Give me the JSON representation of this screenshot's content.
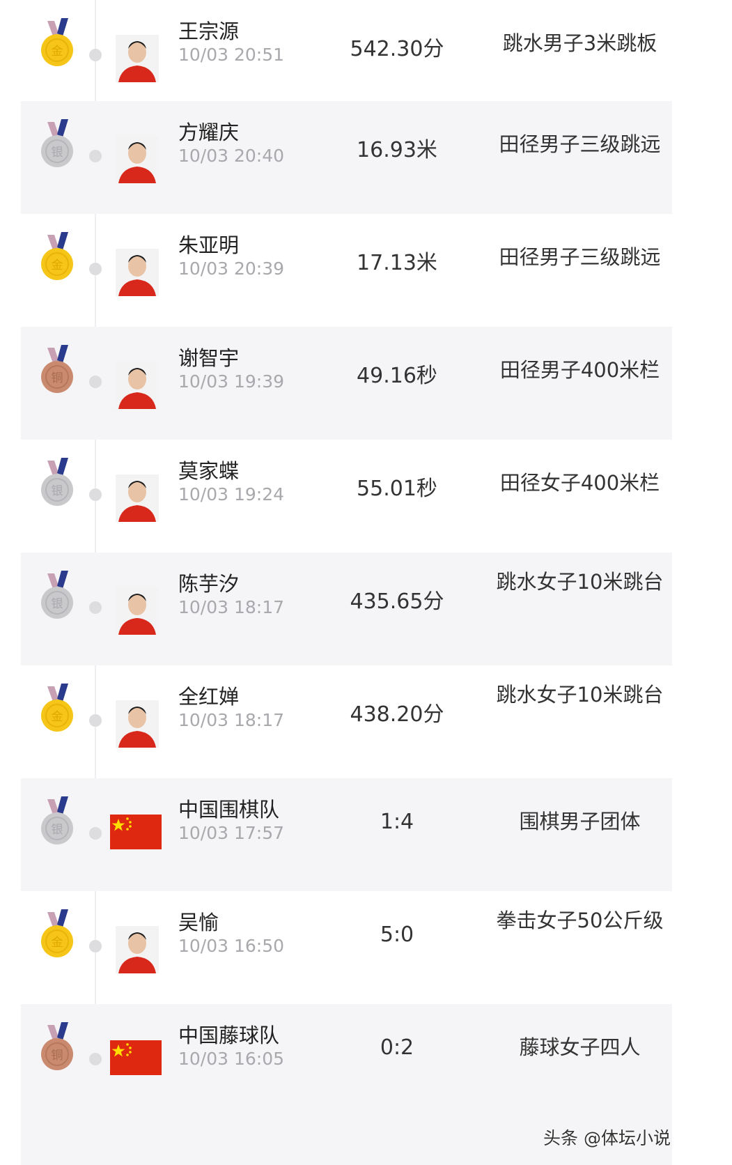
{
  "colors": {
    "gold": "#f5c518",
    "silver": "#c9c9cc",
    "bronze": "#c98a6f",
    "ribbon_blue": "#2a3a8c",
    "ribbon_pink": "#c7a0b4",
    "flag_red": "#de2910",
    "flag_star": "#ffde00"
  },
  "medal_labels": {
    "gold": "金",
    "silver": "银",
    "bronze": "铜"
  },
  "entries": [
    {
      "medal": "gold",
      "avatar": "athlete-photo",
      "name": "王宗源",
      "time": "10/03 20:51",
      "score": "542.30分",
      "event": "跳水男子3米跳板"
    },
    {
      "medal": "silver",
      "avatar": "athlete-photo",
      "name": "方耀庆",
      "time": "10/03 20:40",
      "score": "16.93米",
      "event": "田径男子三级跳远"
    },
    {
      "medal": "gold",
      "avatar": "athlete-photo",
      "name": "朱亚明",
      "time": "10/03 20:39",
      "score": "17.13米",
      "event": "田径男子三级跳远"
    },
    {
      "medal": "bronze",
      "avatar": "athlete-photo",
      "name": "谢智宇",
      "time": "10/03 19:39",
      "score": "49.16秒",
      "event": "田径男子400米栏"
    },
    {
      "medal": "silver",
      "avatar": "athlete-photo",
      "name": "莫家蝶",
      "time": "10/03 19:24",
      "score": "55.01秒",
      "event": "田径女子400米栏"
    },
    {
      "medal": "silver",
      "avatar": "athlete-photo",
      "name": "陈芋汐",
      "time": "10/03 18:17",
      "score": "435.65分",
      "event": "跳水女子10米跳台"
    },
    {
      "medal": "gold",
      "avatar": "athlete-photo",
      "name": "全红婵",
      "time": "10/03 18:17",
      "score": "438.20分",
      "event": "跳水女子10米跳台"
    },
    {
      "medal": "silver",
      "avatar": "china-flag",
      "name": "中国围棋队",
      "time": "10/03 17:57",
      "score": "1:4",
      "event": "围棋男子团体"
    },
    {
      "medal": "gold",
      "avatar": "athlete-photo",
      "name": "吴愉",
      "time": "10/03 16:50",
      "score": "5:0",
      "event": "拳击女子50公斤级"
    },
    {
      "medal": "bronze",
      "avatar": "china-flag",
      "name": "中国藤球队",
      "time": "10/03 16:05",
      "score": "0:2",
      "event": "藤球女子四人"
    }
  ],
  "watermark": "头条 @体坛小说"
}
